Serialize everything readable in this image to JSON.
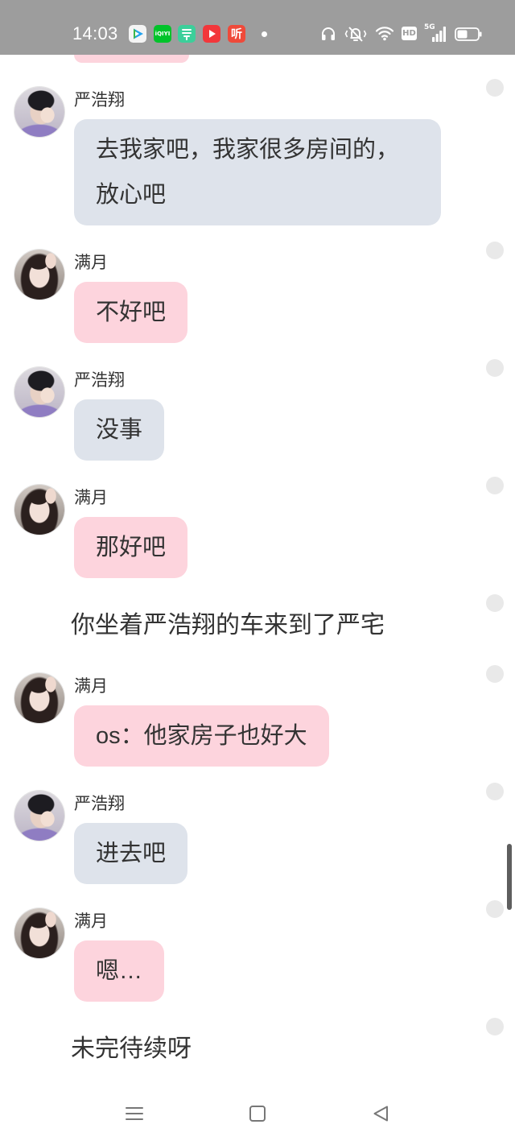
{
  "status_bar": {
    "time": "14:03",
    "notification_icons": [
      "tencent-video-icon",
      "iqiyi-icon",
      "reading-app-icon",
      "video-play-icon",
      "listen-app-icon"
    ],
    "iqiyi_logo_text": "iQIYI",
    "listen_logo_text": "听",
    "system_icons": [
      "headphones-icon",
      "vibrate-mute-icon",
      "wifi-icon",
      "hd-badge",
      "signal-5g-icon",
      "battery-icon"
    ],
    "hd_label": "HD",
    "network_label": "5G",
    "battery_level": 0.5
  },
  "colors": {
    "status_bar": "#9d9d9d",
    "bubble_gray": "#dee3eb",
    "bubble_pink": "#fdd4dd",
    "text": "#333333",
    "select_circle": "#e9e9e9",
    "nav_icon": "#777777"
  },
  "chat": {
    "messages": [
      {
        "type": "message",
        "sender": "严浩翔",
        "avatar": "boy-avatar",
        "bubble": "gray",
        "text": "去我家吧，我家很多房间的，放心吧"
      },
      {
        "type": "message",
        "sender": "满月",
        "avatar": "girl-avatar",
        "bubble": "pink",
        "text": "不好吧"
      },
      {
        "type": "message",
        "sender": "严浩翔",
        "avatar": "boy-avatar",
        "bubble": "gray",
        "text": "没事"
      },
      {
        "type": "message",
        "sender": "满月",
        "avatar": "girl-avatar",
        "bubble": "pink",
        "text": "那好吧"
      },
      {
        "type": "narration",
        "text": "你坐着严浩翔的车来到了严宅"
      },
      {
        "type": "message",
        "sender": "满月",
        "avatar": "girl-avatar",
        "bubble": "pink",
        "text": "os：他家房子也好大"
      },
      {
        "type": "message",
        "sender": "严浩翔",
        "avatar": "boy-avatar",
        "bubble": "gray",
        "text": "进去吧"
      },
      {
        "type": "message",
        "sender": "满月",
        "avatar": "girl-avatar",
        "bubble": "pink",
        "text": "嗯…"
      },
      {
        "type": "narration",
        "text": "未完待续呀"
      }
    ]
  },
  "nav_bar": {
    "icons": [
      "menu-icon",
      "home-icon",
      "back-icon"
    ]
  }
}
